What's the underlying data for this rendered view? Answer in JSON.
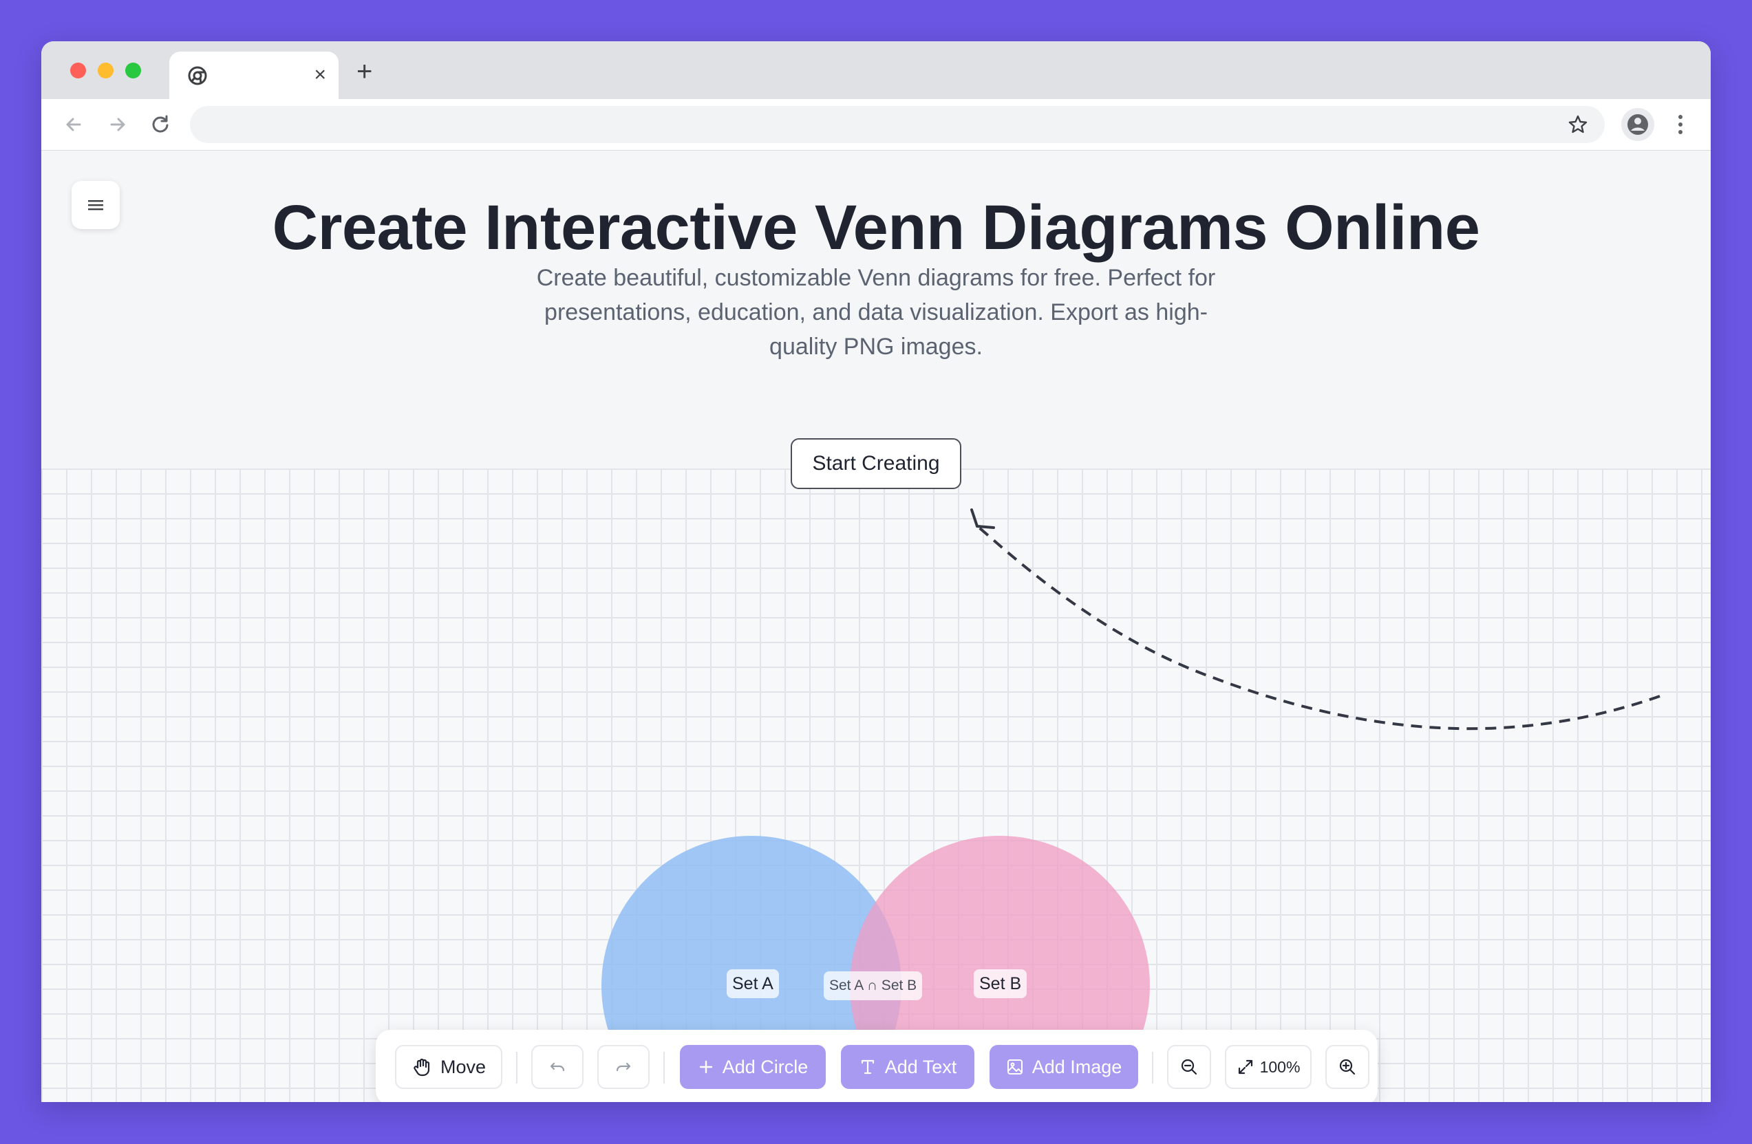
{
  "browser": {
    "tab_close_glyph": "×",
    "new_tab_glyph": "+"
  },
  "hero": {
    "title": "Create Interactive Venn Diagrams Online",
    "subtitle": "Create beautiful, customizable Venn diagrams for free. Perfect for presentations, education, and data visualization. Export as high-quality PNG images.",
    "cta_label": "Start Creating"
  },
  "venn": {
    "set_a_label": "Set A",
    "set_b_label": "Set B",
    "intersection_label": "Set A ∩ Set B",
    "set_a_color": "#8fbdf3",
    "set_b_color": "#f3a3c9"
  },
  "dock": {
    "move_label": "Move",
    "add_circle_label": "Add Circle",
    "add_text_label": "Add Text",
    "add_image_label": "Add Image",
    "zoom_level": "100%"
  },
  "colors": {
    "frame": "#6b55e3",
    "accent_purple": "#a79af0",
    "text_dark": "#1f2430"
  },
  "icons": [
    "menu-icon",
    "hand-icon",
    "undo-icon",
    "redo-icon",
    "plus-icon",
    "text-icon",
    "image-icon",
    "zoom-out-icon",
    "fit-expand-icon",
    "zoom-in-icon",
    "star-icon",
    "profile-icon",
    "back-icon",
    "forward-icon",
    "reload-icon"
  ]
}
